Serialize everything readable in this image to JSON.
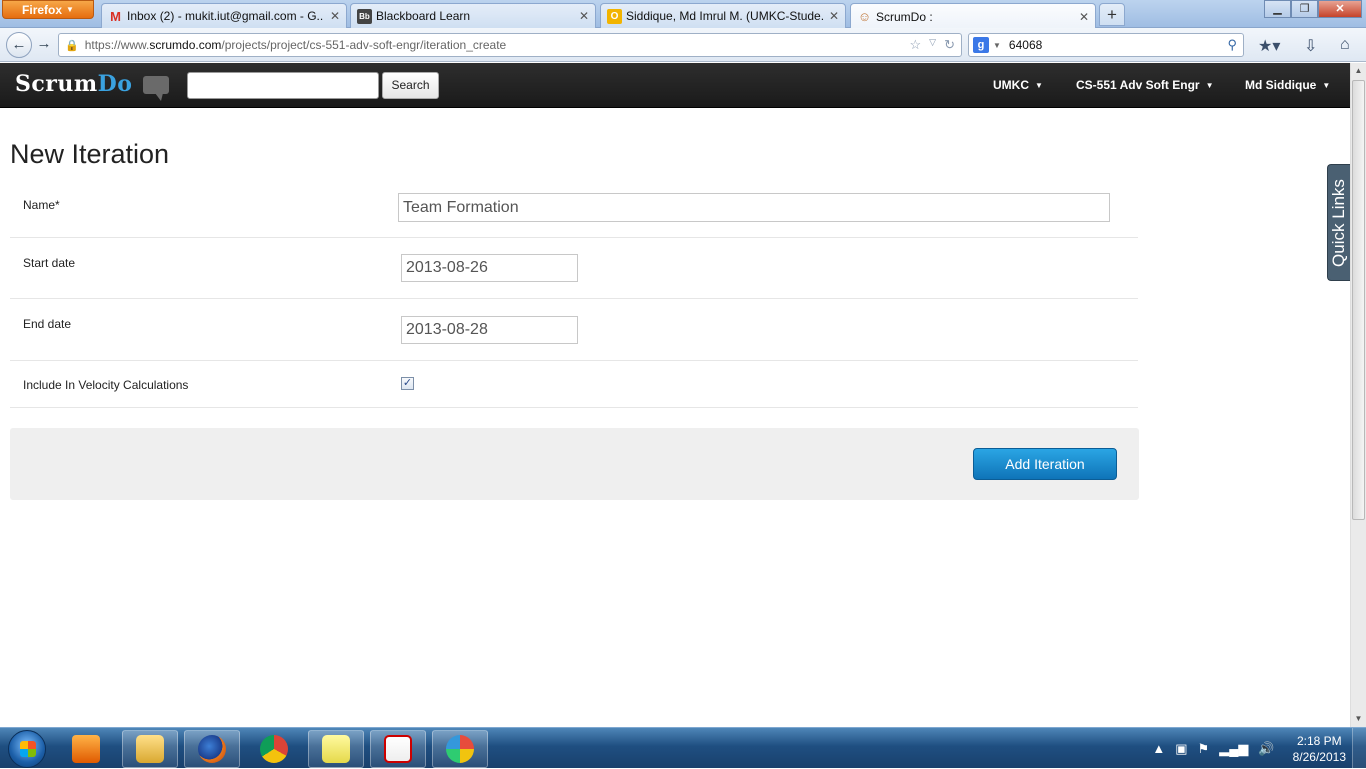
{
  "browser": {
    "menu_label": "Firefox",
    "tabs": [
      {
        "title": "Inbox (2) - mukit.iut@gmail.com - G...",
        "favicon": "M",
        "favicon_color": "#d93025"
      },
      {
        "title": "Blackboard Learn",
        "favicon": "Bb",
        "favicon_color": "#333333"
      },
      {
        "title": "Siddique, Md Imrul M. (UMKC-Stude...",
        "favicon": "O",
        "favicon_color": "#e8a200"
      },
      {
        "title": "ScrumDo :",
        "favicon": "☺",
        "favicon_color": "#c0773a"
      }
    ],
    "url_prefix": "https://www.",
    "url_domain": "scrumdo.com",
    "url_path": "/projects/project/cs-551-adv-soft-engr/iteration_create",
    "search_value": "64068"
  },
  "app": {
    "logo_main": "Scrum",
    "logo_accent": "Do",
    "search_button": "Search",
    "search_value": "",
    "menus": [
      "UMKC",
      "CS-551 Adv Soft Engr",
      "Md Siddique"
    ]
  },
  "form": {
    "title": "New Iteration",
    "name_label": "Name*",
    "name_value": "Team Formation",
    "start_label": "Start date",
    "start_value": "2013-08-26",
    "end_label": "End date",
    "end_value": "2013-08-28",
    "velocity_label": "Include In Velocity Calculations",
    "velocity_checked": true,
    "submit_label": "Add Iteration"
  },
  "quick_links_label": "Quick Links",
  "taskbar": {
    "time": "2:18 PM",
    "date": "8/26/2013"
  },
  "colors": {
    "accent": "#1a8ed4",
    "header_bg": "#222222",
    "logo_accent": "#3aa2e0"
  }
}
